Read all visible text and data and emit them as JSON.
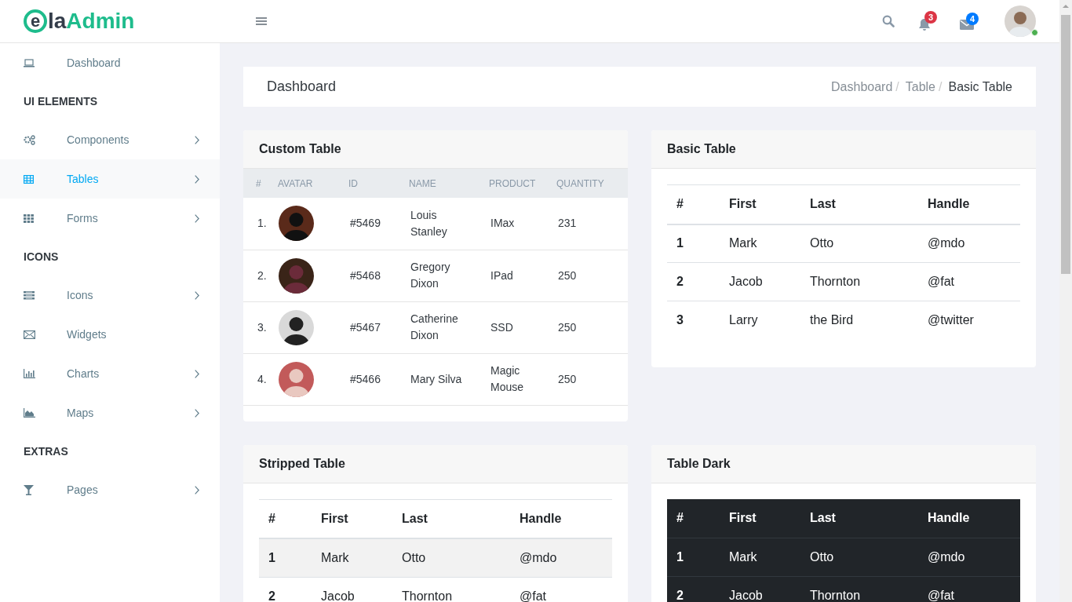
{
  "logo": {
    "mark": "e",
    "text_dark": "la",
    "text_accent": "Admin"
  },
  "header": {
    "notifications": [
      {
        "kind": "bell",
        "count": "3",
        "color": "#dc3545"
      },
      {
        "kind": "mail",
        "count": "4",
        "color": "#007bff"
      }
    ],
    "user": {
      "online": true
    }
  },
  "sidebar": {
    "items": [
      {
        "kind": "link",
        "label": "Dashboard",
        "selected": false,
        "submenu": false
      },
      {
        "kind": "heading",
        "label": "UI ELEMENTS"
      },
      {
        "kind": "link",
        "label": "Components",
        "selected": false,
        "submenu": true
      },
      {
        "kind": "link",
        "label": "Tables",
        "selected": true,
        "submenu": true
      },
      {
        "kind": "link",
        "label": "Forms",
        "selected": false,
        "submenu": true
      },
      {
        "kind": "heading",
        "label": "ICONS"
      },
      {
        "kind": "link",
        "label": "Icons",
        "selected": false,
        "submenu": true
      },
      {
        "kind": "link",
        "label": "Widgets",
        "selected": false,
        "submenu": false
      },
      {
        "kind": "link",
        "label": "Charts",
        "selected": false,
        "submenu": true
      },
      {
        "kind": "link",
        "label": "Maps",
        "selected": false,
        "submenu": true
      },
      {
        "kind": "heading",
        "label": "EXTRAS"
      },
      {
        "kind": "link",
        "label": "Pages",
        "selected": false,
        "submenu": true
      }
    ]
  },
  "page_title": "Dashboard",
  "breadcrumb": [
    {
      "label": "Dashboard",
      "selected": false,
      "separator": "/"
    },
    {
      "label": "Table",
      "selected": false,
      "separator": "/"
    },
    {
      "label": "Basic Table",
      "selected": true
    }
  ],
  "cards": [
    {
      "kind": "custom",
      "title": "Custom Table",
      "columns": [
        "#",
        "AVATAR",
        "ID",
        "NAME",
        "PRODUCT",
        "QUANTITY"
      ],
      "rows": [
        [
          "1.",
          "",
          "#5469",
          "Louis Stanley",
          "IMax",
          "231"
        ],
        [
          "2.",
          "",
          "#5468",
          "Gregory Dixon",
          "IPad",
          "250"
        ],
        [
          "3.",
          "",
          "#5467",
          "Catherine Dixon",
          "SSD",
          "250"
        ],
        [
          "4.",
          "",
          "#5466",
          "Mary Silva",
          "Magic Mouse",
          "250"
        ]
      ]
    },
    {
      "kind": "basic",
      "title": "Basic Table",
      "columns": [
        "#",
        "First",
        "Last",
        "Handle"
      ],
      "rows": [
        [
          "1",
          "Mark",
          "Otto",
          "@mdo"
        ],
        [
          "2",
          "Jacob",
          "Thornton",
          "@fat"
        ],
        [
          "3",
          "Larry",
          "the Bird",
          "@twitter"
        ]
      ]
    },
    {
      "kind": "striped",
      "title": "Stripped Table",
      "columns": [
        "#",
        "First",
        "Last",
        "Handle"
      ],
      "rows": [
        [
          "1",
          "Mark",
          "Otto",
          "@mdo"
        ],
        [
          "2",
          "Jacob",
          "Thornton",
          "@fat"
        ]
      ]
    },
    {
      "kind": "dark",
      "title": "Table Dark",
      "columns": [
        "#",
        "First",
        "Last",
        "Handle"
      ],
      "rows": [
        [
          "1",
          "Mark",
          "Otto",
          "@mdo"
        ],
        [
          "2",
          "Jacob",
          "Thornton",
          "@fat"
        ]
      ]
    }
  ]
}
